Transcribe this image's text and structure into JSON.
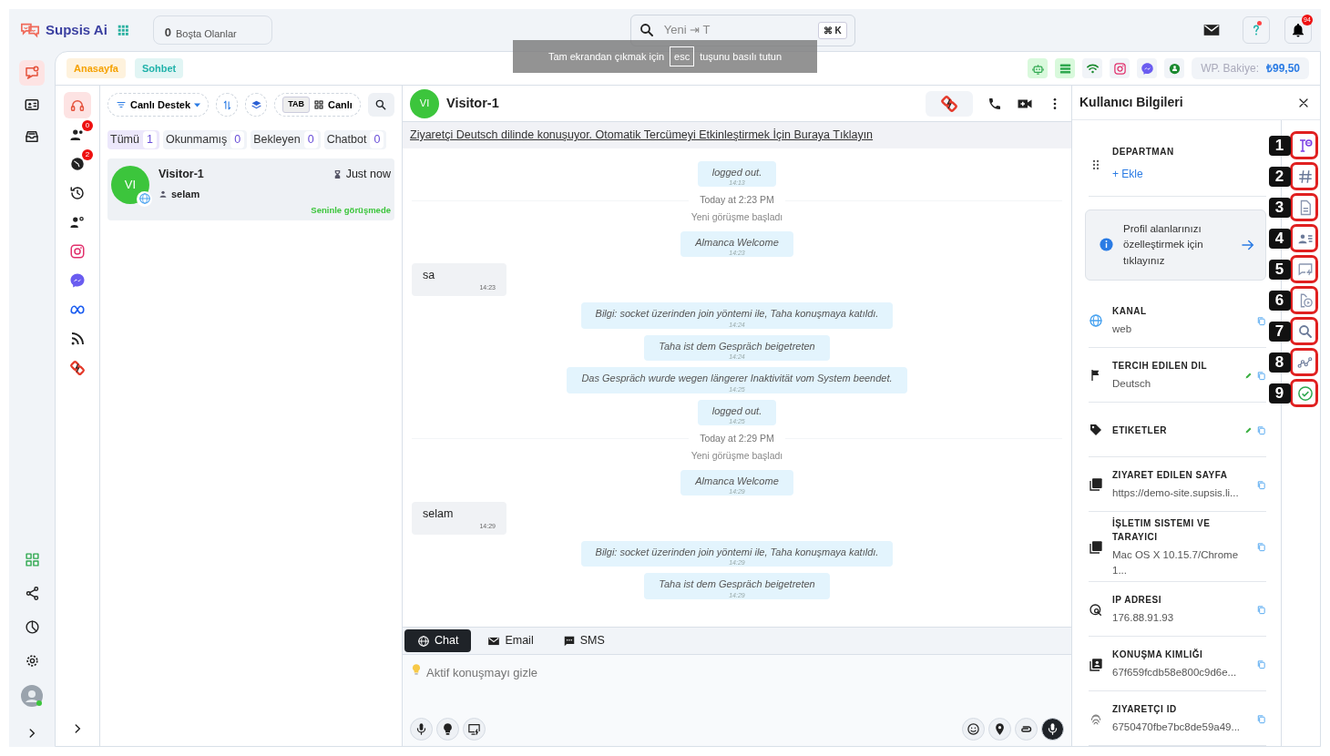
{
  "topbar": {
    "brand": "Supsis Ai",
    "idle_count": "0",
    "idle_label": "Boşta Olanlar",
    "search_value": "Yeni ⇥ T",
    "search_shortcut": "⌘ K",
    "toast_before": "Tam ekrandan çıkmak için",
    "toast_key": "esc",
    "toast_after": "tuşunu basılı tutun",
    "help_dot": true,
    "notification_count": "94"
  },
  "nav_rail": [
    {
      "selected": true
    },
    {
      "selected": false
    },
    {
      "selected": false
    }
  ],
  "page_tabs": [
    {
      "label": "Anasayfa",
      "color": "#f5a100"
    },
    {
      "label": "Sohbet",
      "color": "#20b2aa"
    }
  ],
  "channel_status": [
    {
      "active": true
    },
    {
      "active": true
    },
    {
      "active": false
    },
    {
      "active": false
    },
    {
      "active": false
    },
    {
      "active": false
    }
  ],
  "balance": {
    "label": "WP. Bakiye:",
    "value": "₺99,50"
  },
  "channel_rail": [
    {
      "selected": true
    },
    {
      "selected": false,
      "badge": "0"
    },
    {
      "selected": false,
      "badge": "2"
    },
    {
      "selected": false
    },
    {
      "selected": false
    },
    {
      "selected": false
    },
    {
      "selected": false
    },
    {
      "selected": false
    },
    {
      "selected": false
    },
    {
      "selected": false
    }
  ],
  "list_toolbar": {
    "department": "Canlı Destek",
    "tab_key": "TAB",
    "mode": "Canlı"
  },
  "filters": [
    {
      "label": "Tümü",
      "count": "1",
      "selected": true
    },
    {
      "label": "Okunmamış",
      "count": "0",
      "selected": false
    },
    {
      "label": "Bekleyen",
      "count": "0",
      "selected": false
    },
    {
      "label": "Chatbot",
      "count": "0",
      "selected": false
    }
  ],
  "conversations": [
    {
      "initials": "VI",
      "name": "Visitor-1",
      "time": "Just now",
      "last_message": "selam",
      "status": "Seninle görüşmede",
      "selected": true
    }
  ],
  "chat": {
    "initials": "VI",
    "name": "Visitor-1",
    "translate_banner": "Ziyaretçi Deutsch dilinde konuşuyor. Otomatik Tercümeyi Etkinleştirmek İçin Buraya Tıklayın",
    "messages": [
      {
        "kind": "system",
        "text": "logged out.",
        "time": "14:13"
      },
      {
        "kind": "date",
        "text": "Today at 2:23 PM"
      },
      {
        "kind": "notice",
        "text": "Yeni görüşme başladı"
      },
      {
        "kind": "system",
        "text": "Almanca Welcome",
        "time": "14:23"
      },
      {
        "kind": "visitor",
        "text": "sa",
        "time": "14:23"
      },
      {
        "kind": "system",
        "text": "Bilgi: socket üzerinden join yöntemi ile, Taha konuşmaya katıldı.",
        "time": "14:24"
      },
      {
        "kind": "system",
        "text": "Taha ist dem Gespräch beigetreten",
        "time": "14:24"
      },
      {
        "kind": "system",
        "text": "Das Gespräch wurde wegen längerer Inaktivität vom System beendet.",
        "time": "14:25"
      },
      {
        "kind": "system",
        "text": "logged out.",
        "time": "14:25"
      },
      {
        "kind": "date",
        "text": "Today at 2:29 PM"
      },
      {
        "kind": "notice",
        "text": "Yeni görüşme başladı"
      },
      {
        "kind": "system",
        "text": "Almanca Welcome",
        "time": "14:29"
      },
      {
        "kind": "visitor",
        "text": "selam",
        "time": "14:29"
      },
      {
        "kind": "system",
        "text": "Bilgi: socket üzerinden join yöntemi ile, Taha konuşmaya katıldı.",
        "time": "14:29"
      },
      {
        "kind": "system",
        "text": "Taha ist dem Gespräch beigetreten",
        "time": "14:29"
      }
    ],
    "channels": [
      {
        "label": "Chat",
        "selected": true
      },
      {
        "label": "Email",
        "selected": false
      },
      {
        "label": "SMS",
        "selected": false
      }
    ],
    "composer_placeholder": "Aktif konuşmayı gizle"
  },
  "user_info": {
    "title": "Kullanıcı Bilgileri",
    "fields": [
      {
        "kind": "action",
        "label": "DEPARTMAN",
        "action": "+ Ekle"
      },
      {
        "kind": "info",
        "text": "Profil alanlarınızı özelleştirmek için tıklayınız"
      },
      {
        "kind": "field",
        "label": "KANAL",
        "value": "web",
        "editable": false,
        "copyable": true
      },
      {
        "kind": "field",
        "label": "TERCIH EDILEN DIL",
        "value": "Deutsch",
        "editable": true,
        "copyable": true
      },
      {
        "kind": "field",
        "label": "ETIKETLER",
        "editable": true,
        "copyable": true
      },
      {
        "kind": "field",
        "label": "ZIYARET EDILEN SAYFA",
        "value": "https://demo-site.supsis.li...",
        "editable": false,
        "copyable": true
      },
      {
        "kind": "field",
        "label": "İŞLETIM SISTEMI VE TARAYICI",
        "value": "Mac OS X 10.15.7/Chrome 1...",
        "editable": false,
        "copyable": true
      },
      {
        "kind": "field",
        "label": "IP ADRESI",
        "value": "176.88.91.93",
        "editable": false,
        "copyable": true
      },
      {
        "kind": "field",
        "label": "KONUŞMA KIMLIĞI",
        "value": "67f659fcdb58e800c9d6e...",
        "editable": false,
        "copyable": true
      },
      {
        "kind": "field",
        "label": "ZIYARETÇI ID",
        "value": "6750470fbe7bc8de59a49...",
        "editable": false,
        "copyable": true
      }
    ],
    "tool_numbers": [
      "1",
      "2",
      "3",
      "4",
      "5",
      "6",
      "7",
      "8",
      "9"
    ]
  }
}
